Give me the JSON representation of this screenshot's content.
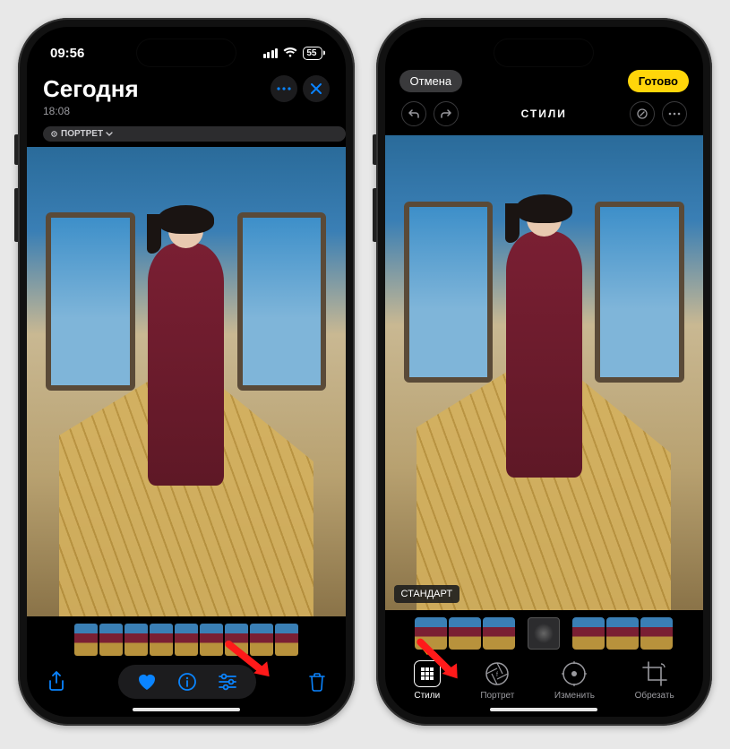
{
  "status": {
    "time": "09:56",
    "battery": "55"
  },
  "left": {
    "title": "Сегодня",
    "subtitle": "18:08",
    "badge": "ПОРТРЕТ",
    "actions": {
      "more": "more-icon",
      "close": "close-icon"
    },
    "toolbar": {
      "share": "share-icon",
      "favorite": "heart-icon",
      "info": "info-icon",
      "edit": "sliders-icon",
      "delete": "trash-icon"
    }
  },
  "right": {
    "cancel": "Отмена",
    "done": "Готово",
    "mode_title": "СТИЛИ",
    "top_actions": {
      "undo": "undo-icon",
      "redo": "redo-icon",
      "markup": "markup-icon",
      "more": "more-icon"
    },
    "style_label": "СТАНДАРТ",
    "tabs": [
      {
        "id": "styles",
        "label": "Стили",
        "selected": true
      },
      {
        "id": "portrait",
        "label": "Портрет",
        "selected": false
      },
      {
        "id": "adjust",
        "label": "Изменить",
        "selected": false
      },
      {
        "id": "crop",
        "label": "Обрезать",
        "selected": false
      }
    ]
  },
  "colors": {
    "accent_blue": "#0a84ff",
    "accent_yellow": "#ffd60a",
    "arrow": "#ff1a1a"
  }
}
